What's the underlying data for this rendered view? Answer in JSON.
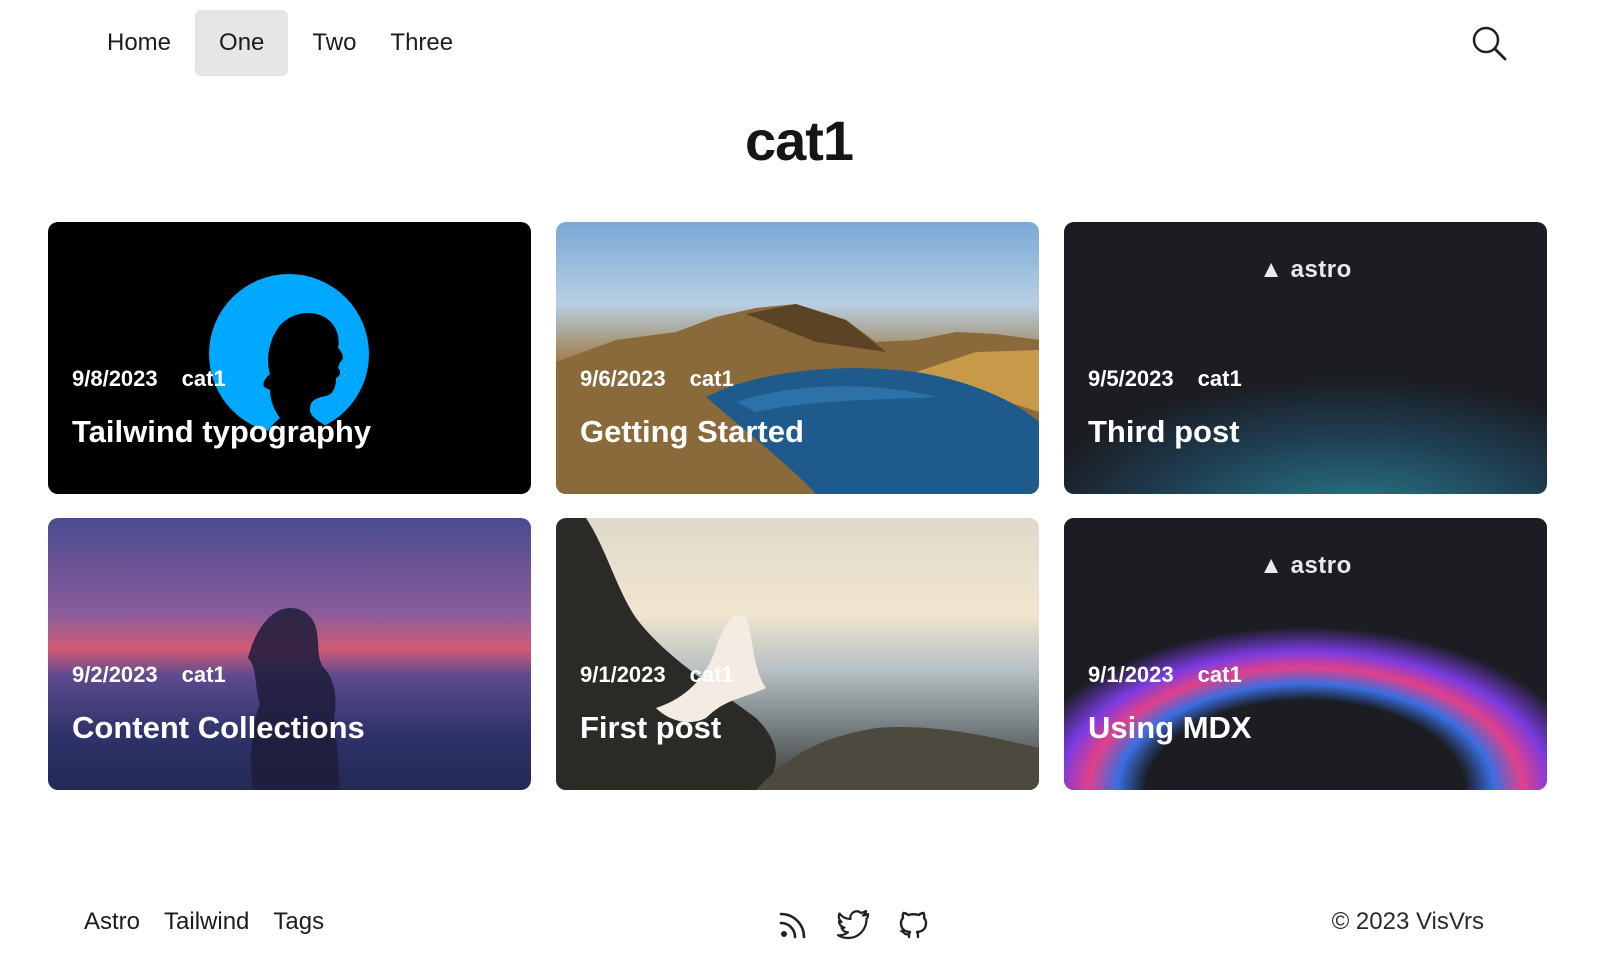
{
  "nav": {
    "items": [
      {
        "label": "Home",
        "active": false
      },
      {
        "label": "One",
        "active": true
      },
      {
        "label": "Two",
        "active": false
      },
      {
        "label": "Three",
        "active": false
      }
    ],
    "search_icon": "search-icon"
  },
  "page": {
    "title": "cat1"
  },
  "posts": [
    {
      "date": "9/8/2023",
      "category": "cat1",
      "title": "Tailwind typography",
      "image": "silhouette-profile"
    },
    {
      "date": "9/6/2023",
      "category": "cat1",
      "title": "Getting Started",
      "image": "mountain-lake"
    },
    {
      "date": "9/5/2023",
      "category": "cat1",
      "title": "Third post",
      "image": "astro-logo",
      "logo": "astro"
    },
    {
      "date": "9/2/2023",
      "category": "cat1",
      "title": "Content Collections",
      "image": "sunset-silhouette"
    },
    {
      "date": "9/1/2023",
      "category": "cat1",
      "title": "First post",
      "image": "bride-seaside"
    },
    {
      "date": "9/1/2023",
      "category": "cat1",
      "title": "Using MDX",
      "image": "astro-logo-rainbow",
      "logo": "astro"
    }
  ],
  "footer": {
    "links": [
      "Astro",
      "Tailwind",
      "Tags"
    ],
    "social_icons": [
      "rss-icon",
      "twitter-icon",
      "github-icon"
    ],
    "copyright": "© 2023 VisVrs"
  }
}
